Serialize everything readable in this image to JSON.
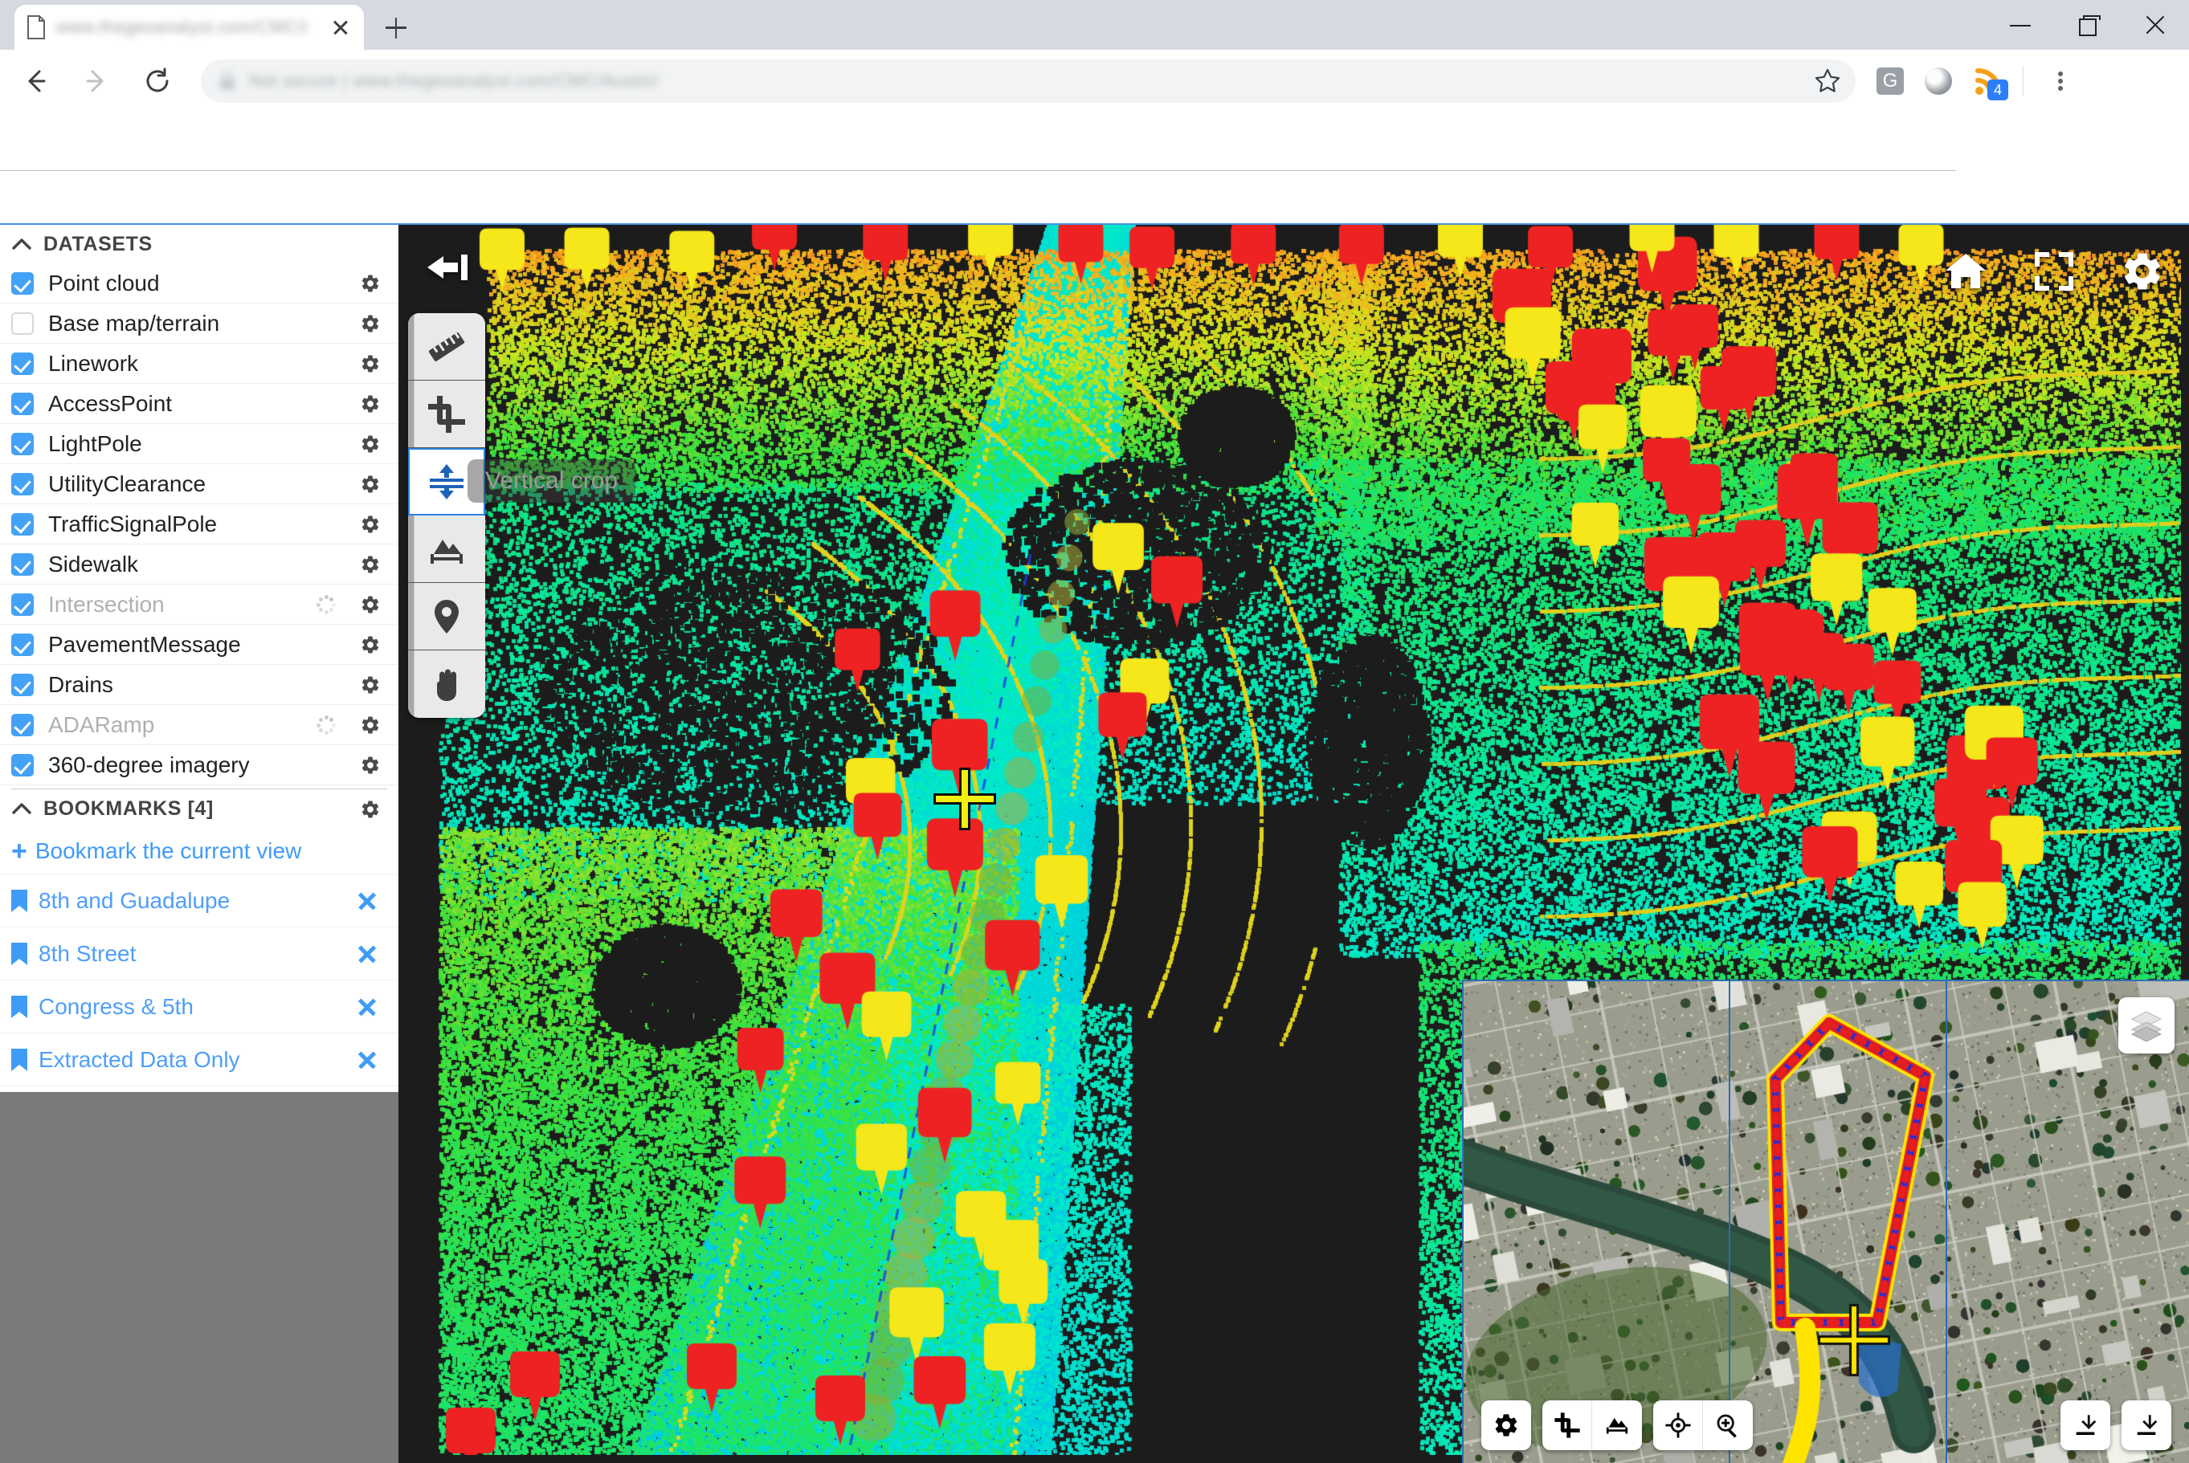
{
  "browser": {
    "tab_title": "www.thegeoanalyst.com/CMC/i",
    "new_tab_label": "+",
    "omnibox_text": "Not secure  |  www.thegeoanalyst.com/CMC/Austin/",
    "extension_g_label": "G",
    "rss_badge": "4",
    "window_controls": {
      "minimize": "Minimize",
      "restore": "Restore",
      "close": "Close"
    },
    "nav": {
      "back": "Back",
      "forward": "Forward",
      "reload": "Reload"
    }
  },
  "sidebar": {
    "datasets": {
      "title": "DATASETS",
      "items": [
        {
          "label": "Point cloud",
          "checked": true,
          "dim": false,
          "loading": false
        },
        {
          "label": "Base map/terrain",
          "checked": false,
          "dim": false,
          "loading": false
        },
        {
          "label": "Linework",
          "checked": true,
          "dim": false,
          "loading": false
        },
        {
          "label": "AccessPoint",
          "checked": true,
          "dim": false,
          "loading": false
        },
        {
          "label": "LightPole",
          "checked": true,
          "dim": false,
          "loading": false
        },
        {
          "label": "UtilityClearance",
          "checked": true,
          "dim": false,
          "loading": false
        },
        {
          "label": "TrafficSignalPole",
          "checked": true,
          "dim": false,
          "loading": false
        },
        {
          "label": "Sidewalk",
          "checked": true,
          "dim": false,
          "loading": false
        },
        {
          "label": "Intersection",
          "checked": true,
          "dim": true,
          "loading": true
        },
        {
          "label": "PavementMessage",
          "checked": true,
          "dim": false,
          "loading": false
        },
        {
          "label": "Drains",
          "checked": true,
          "dim": false,
          "loading": false
        },
        {
          "label": "ADARamp",
          "checked": true,
          "dim": true,
          "loading": true
        },
        {
          "label": "360-degree imagery",
          "checked": true,
          "dim": false,
          "loading": false
        }
      ]
    },
    "bookmarks": {
      "title": "BOOKMARKS [4]",
      "add_label": "Bookmark the current view",
      "add_plus": "+",
      "items": [
        {
          "label": "8th and Guadalupe"
        },
        {
          "label": "8th Street"
        },
        {
          "label": "Congress & 5th"
        },
        {
          "label": "Extracted Data Only"
        }
      ]
    }
  },
  "viewport": {
    "tooltip": "Vertical crop",
    "tools": [
      {
        "name": "measure",
        "active": false
      },
      {
        "name": "crop",
        "active": false
      },
      {
        "name": "vertical-crop",
        "active": true
      },
      {
        "name": "profile",
        "active": false
      },
      {
        "name": "marker",
        "active": false
      },
      {
        "name": "pan",
        "active": false
      }
    ],
    "controls": [
      {
        "name": "home"
      },
      {
        "name": "fullscreen"
      },
      {
        "name": "settings"
      }
    ],
    "collapse_icon": "collapse-left"
  },
  "minimap": {
    "layers_icon": "layers",
    "toolbar_left": [
      "settings",
      "crop",
      "profile",
      "recenter",
      "zoom-in"
    ],
    "toolbar_right": [
      "expand-corner",
      "expand-corner"
    ]
  },
  "colors": {
    "accent_blue": "#43a2f5",
    "link_blue": "#3f9cf6",
    "active_border": "#2b83e0",
    "viewport_bg": "#1c1c1c",
    "chrome_bg": "#d6dae0"
  }
}
